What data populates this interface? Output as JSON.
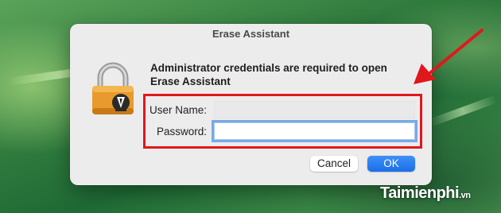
{
  "window": {
    "title": "Erase Assistant"
  },
  "message": {
    "line1": "Administrator credentials are required to open",
    "line2": "Erase Assistant"
  },
  "form": {
    "username_label": "User Name:",
    "username_value": "",
    "password_label": "Password:",
    "password_value": ""
  },
  "buttons": {
    "cancel": "Cancel",
    "ok": "OK"
  },
  "icons": {
    "dialog_icon": "padlock-icon",
    "annotation": "red-arrow-icon"
  },
  "colors": {
    "highlight": "#e0181c",
    "accent": "#1a6fe8",
    "focus_ring": "#7aa9e6"
  },
  "watermark": {
    "brand": "Taimienphi",
    "suffix": ".vn"
  }
}
